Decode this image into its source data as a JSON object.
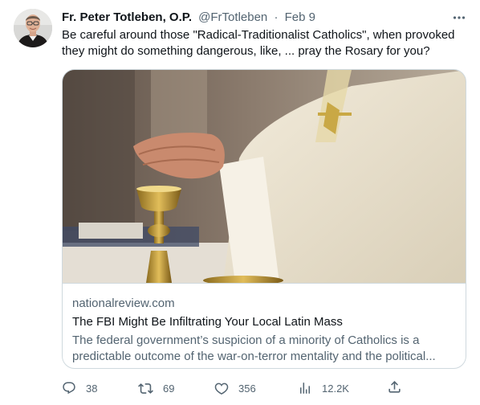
{
  "author": {
    "display_name": "Fr. Peter Totleben, O.P.",
    "handle": "@FrTotleben",
    "separator": "·",
    "date": "Feb 9"
  },
  "more_icon": "more-horizontal-icon",
  "tweet": {
    "line1": "Be careful around those \"Radical-Traditionalist Catholics\", when provoked",
    "line2": "they might do something dangerous, like, ... pray the Rosary for you?"
  },
  "card": {
    "domain": "nationalreview.com",
    "title": "The FBI Might Be Infiltrating Your Local Latin Mass",
    "description_line1": "The federal government’s suspicion of a minority of Catholics is a",
    "description_line2": "predictable outcome of the war-on-terror mentality and the political..."
  },
  "actions": {
    "replies": "38",
    "retweets": "69",
    "likes": "356",
    "views": "12.2K"
  },
  "icons": {
    "reply": "reply-icon",
    "retweet": "retweet-icon",
    "like": "heart-icon",
    "views": "views-bar-chart-icon",
    "share": "share-icon"
  },
  "colors": {
    "text_primary": "#0f1419",
    "text_secondary": "#536471",
    "border": "#cfd9de"
  }
}
